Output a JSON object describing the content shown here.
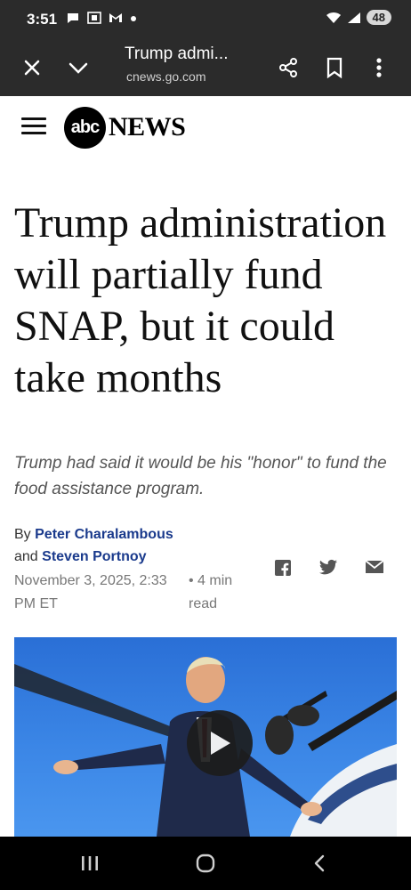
{
  "status_bar": {
    "time": "3:51",
    "battery": "48",
    "left_icons": [
      "chat-icon",
      "screenshot-icon",
      "gmail-icon",
      "dot-icon"
    ],
    "right_icons": [
      "wifi-icon",
      "signal-icon",
      "battery-icon"
    ]
  },
  "browser": {
    "title": "Trump admi...",
    "url": "cnews.go.com",
    "buttons": [
      "close-icon",
      "chevron-down-icon",
      "share-icon",
      "bookmark-icon",
      "more-icon"
    ]
  },
  "site": {
    "logo_text": "abc",
    "logo_suffix": "NEWS"
  },
  "article": {
    "headline": "Trump administration will partially fund SNAP, but it could take months",
    "subhead": "Trump had said it would be his \"honor\" to fund the food assistance program.",
    "by_prefix": "By",
    "author1": "Peter Charalambous",
    "and_word": "and",
    "author2": "Steven Portnoy",
    "date": "November 3, 2025, 2:33 PM ET",
    "read_time": "• 4 min read",
    "share": [
      "facebook-icon",
      "twitter-icon",
      "email-icon"
    ]
  },
  "nav": {
    "buttons": [
      "recent-apps-icon",
      "home-icon",
      "back-icon"
    ]
  }
}
